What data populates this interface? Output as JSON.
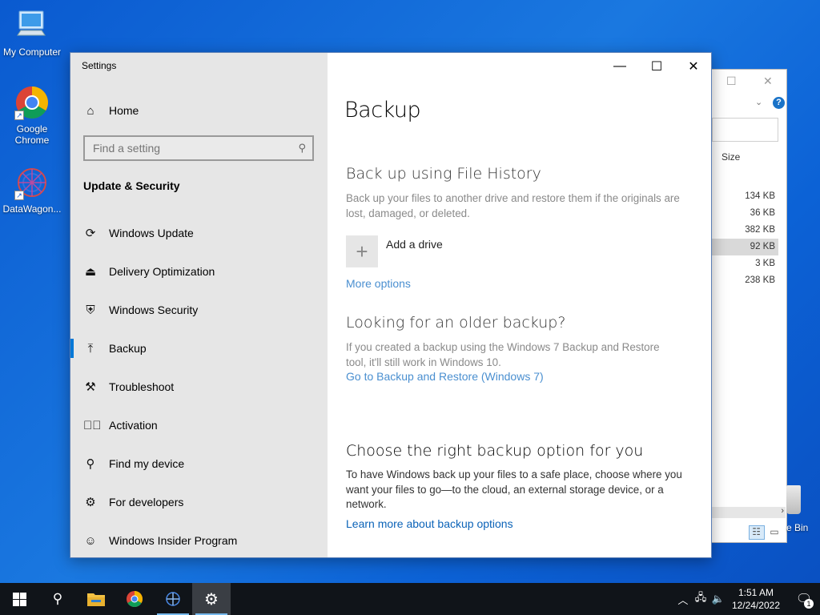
{
  "desktop": {
    "icons": [
      {
        "label": "My Computer"
      },
      {
        "label": "Google Chrome"
      },
      {
        "label": "DataWagon..."
      }
    ],
    "recycle_bin_label": "e Bin"
  },
  "explorer": {
    "size_header": "Size",
    "sizes": [
      "134 KB",
      "36 KB",
      "382 KB",
      "92 KB",
      "3 KB",
      "238 KB"
    ],
    "selected_index": 3
  },
  "settings": {
    "app_title": "Settings",
    "home_label": "Home",
    "search_placeholder": "Find a setting",
    "section_title": "Update & Security",
    "nav": [
      {
        "label": "Windows Update",
        "icon": "refresh-icon"
      },
      {
        "label": "Delivery Optimization",
        "icon": "delivery-icon"
      },
      {
        "label": "Windows Security",
        "icon": "shield-icon"
      },
      {
        "label": "Backup",
        "icon": "backup-arrow-icon",
        "active": true
      },
      {
        "label": "Troubleshoot",
        "icon": "wrench-icon"
      },
      {
        "label": "Activation",
        "icon": "check-circle-icon"
      },
      {
        "label": "Find my device",
        "icon": "person-pin-icon"
      },
      {
        "label": "For developers",
        "icon": "developer-icon"
      },
      {
        "label": "Windows Insider Program",
        "icon": "insider-cat-icon"
      }
    ],
    "content": {
      "page_title": "Backup",
      "file_history": {
        "heading": "Back up using File History",
        "description": "Back up your files to another drive and restore them if the originals are lost, damaged, or deleted.",
        "add_drive_label": "Add a drive",
        "more_options_label": "More options"
      },
      "older_backup": {
        "heading": "Looking for an older backup?",
        "description": "If you created a backup using the Windows 7 Backup and Restore tool, it'll still work in Windows 10.",
        "link_label": "Go to Backup and Restore (Windows 7)"
      },
      "choose": {
        "heading": "Choose the right backup option for you",
        "description": "To have Windows back up your files to a safe place, choose where you want your files to go—to the cloud, an external storage device, or a network.",
        "link_label": "Learn more about backup options"
      }
    }
  },
  "taskbar": {
    "time": "1:51 AM",
    "date": "12/24/2022",
    "notification_count": "1"
  },
  "colors": {
    "accent": "#0078d7",
    "link": "#4a8fd0",
    "sidebar_bg": "#e6e6e6",
    "taskbar_bg": "#101419"
  }
}
